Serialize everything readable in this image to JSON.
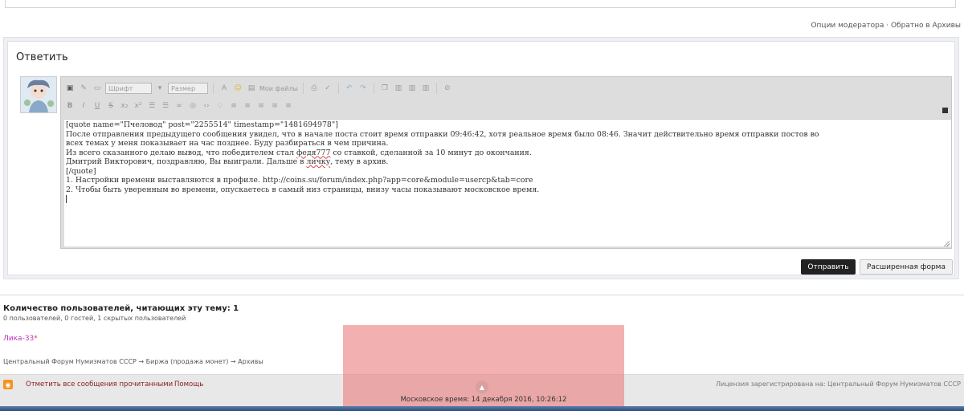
{
  "moderator_links": {
    "options": "Опции модератора",
    "separator": "·",
    "back": "Обратно в Архивы"
  },
  "reply": {
    "title": "Ответить",
    "toolbar": {
      "font_select": "Шрифт",
      "size_select": "Размер",
      "my_files": "Мои файлы",
      "row1_icons": [
        "source-icon",
        "brush-icon",
        "image-icon",
        "font-color-icon",
        "smiley-icon",
        "my-files-icon",
        "print-icon",
        "spellcheck-icon",
        "undo-icon",
        "redo-icon",
        "copy-icon",
        "paste-icon",
        "paste-text-icon",
        "paste-word-icon",
        "remove-format-icon"
      ],
      "row2_icons": [
        "B",
        "I",
        "U",
        "S",
        "x₂",
        "x²",
        "☰",
        "☰",
        "∞",
        "◎",
        "‹›",
        "♢",
        "≡",
        "≡",
        "≡",
        "≡",
        "≡"
      ]
    },
    "text_lines": {
      "line1": "[quote name=\"Пчеловод\" post=\"2255514\" timestamp=\"1481694978\"]",
      "line2": "После отправления предыдущего сообщения увидел, что в начале поста стоит время отправки 09:46:42, хотя реальное время было 08:46. Значит действительно время отправки постов во",
      "line3": "всех темах у меня показывает на час позднее. Буду разбираться в чем причина.",
      "line4_a": "Из всего сказанного делаю вывод, что победителем стал ",
      "line4_u": "федя777",
      "line4_b": " со ставкой, сделанной за 10 минут до окончания.",
      "line5_a": "Дмитрий Викторович, поздравляю, Вы выиграли. Дальше в ",
      "line5_u": "личку",
      "line5_b": ", тему в архив.",
      "line6": "[/quote]",
      "line7": "1. Настройки времени выставляются в профиле. http://coins.su/forum/index.php?app=core&module=usercp&tab=core",
      "line8": "2. Чтобы быть уверенным во времени, опускаетесь в самый низ страницы, внизу часы показывают московское время."
    },
    "submit_label": "Отправить",
    "full_form_label": "Расширенная форма"
  },
  "viewers": {
    "title": "Количество пользователей, читающих эту тему: 1",
    "subtitle": "0 пользователей, 0 гостей, 1 скрытых пользователей",
    "user": "Лика-33",
    "user_mark": "*"
  },
  "breadcrumb": {
    "item1": "Центральный Форум Нумизматов СССР",
    "arrow": "→",
    "item2": "Биржа (продажа монет)",
    "item3": "Архивы"
  },
  "footer": {
    "mark_read": "Отметить все сообщения прочитанными",
    "help": "Помощь",
    "license": "Лицензия зарегистрирована на: Центральный Форум Нумизматов СССР",
    "moscow_time": "Московское время: 14 декабря 2016, 10:26:12"
  },
  "colors": {
    "overlay": "#ec8080",
    "user_link": "#c030c0",
    "footer_link": "#8b1a1a",
    "submit_bg": "#222222"
  }
}
